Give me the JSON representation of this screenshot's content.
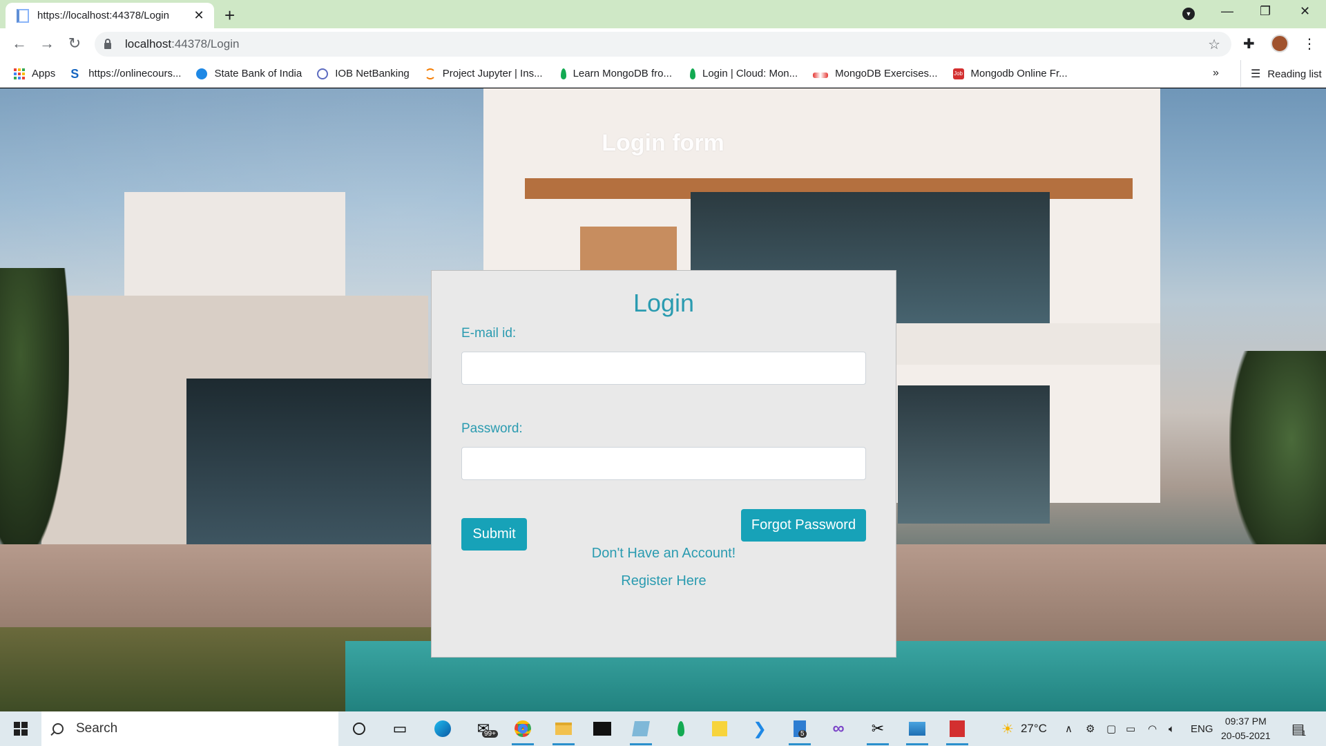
{
  "browser": {
    "tab_title": "https://localhost:44378/Login",
    "url_host": "localhost",
    "url_path": ":44378/Login",
    "bookmarks": [
      {
        "label": "Apps",
        "icon": "apps-grid-icon"
      },
      {
        "label": "https://onlinecours...",
        "icon": "s-logo-icon"
      },
      {
        "label": "State Bank of India",
        "icon": "sbi-icon"
      },
      {
        "label": "IOB NetBanking",
        "icon": "iob-icon"
      },
      {
        "label": "Project Jupyter | Ins...",
        "icon": "jupyter-icon"
      },
      {
        "label": "Learn MongoDB fro...",
        "icon": "mongodb-leaf-icon"
      },
      {
        "label": "Login | Cloud: Mon...",
        "icon": "mongodb-leaf-icon"
      },
      {
        "label": "MongoDB Exercises...",
        "icon": "w3resource-icon"
      },
      {
        "label": "Mongodb Online Fr...",
        "icon": "job-icon"
      }
    ],
    "more_bookmarks": "»",
    "reading_list": "Reading list"
  },
  "page": {
    "heading": "Login form",
    "card": {
      "title": "Login",
      "email_label": "E-mail id:",
      "email_value": "",
      "password_label": "Password:",
      "password_value": "",
      "submit_label": "Submit",
      "forgot_label": "Forgot Password",
      "no_account_text": "Don't Have an Account!",
      "register_text": "Register Here"
    }
  },
  "taskbar": {
    "search_placeholder": "Search",
    "mail_badge": "99+",
    "files_badge": "5",
    "temperature": "27°C",
    "language": "ENG",
    "time": "09:37 PM",
    "date": "20-05-2021",
    "notification_count": "1"
  },
  "colors": {
    "accent": "#17a2b8",
    "label_text": "#2a9bb0",
    "card_bg": "#e9e9e9",
    "tabstrip": "#cfe8c6"
  }
}
